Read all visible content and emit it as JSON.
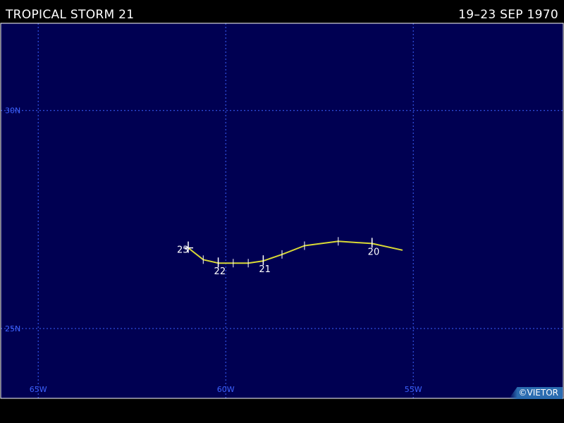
{
  "header": {
    "storm_name": "TROPICAL STORM 21",
    "date_range": "19–23 SEP 1970"
  },
  "map": {
    "colors": {
      "ocean": "#000052",
      "grid": "#3d62ff",
      "track": "#d9d935",
      "border": "#ffffff",
      "marker": "#ffffff"
    },
    "lon_range": [
      -66,
      -51
    ],
    "lat_range": [
      23.4,
      32.0
    ],
    "lon_lines": [
      {
        "value": -65,
        "label": "65W"
      },
      {
        "value": -60,
        "label": "60W"
      },
      {
        "value": -55,
        "label": "55W"
      }
    ],
    "lat_lines": [
      {
        "value": 30,
        "label": "30N"
      },
      {
        "value": 25,
        "label": "25N"
      }
    ],
    "track": [
      {
        "lon": -55.3,
        "lat": 26.8
      },
      {
        "lon": -56.1,
        "lat": 26.95
      },
      {
        "lon": -57.0,
        "lat": 27.0
      },
      {
        "lon": -57.9,
        "lat": 26.9
      },
      {
        "lon": -58.5,
        "lat": 26.7
      },
      {
        "lon": -59.0,
        "lat": 26.55
      },
      {
        "lon": -59.4,
        "lat": 26.5
      },
      {
        "lon": -59.8,
        "lat": 26.5
      },
      {
        "lon": -60.2,
        "lat": 26.5
      },
      {
        "lon": -60.6,
        "lat": 26.58
      },
      {
        "lon": -61.0,
        "lat": 26.85
      }
    ],
    "day_markers": [
      {
        "label": "20",
        "lon": -56.1,
        "lat": 26.95
      },
      {
        "label": "21",
        "lon": -59.0,
        "lat": 26.55
      },
      {
        "label": "22",
        "lon": -60.2,
        "lat": 26.5
      },
      {
        "label": "23",
        "lon": -61.0,
        "lat": 26.85
      }
    ]
  },
  "credit": "©VIETOR"
}
